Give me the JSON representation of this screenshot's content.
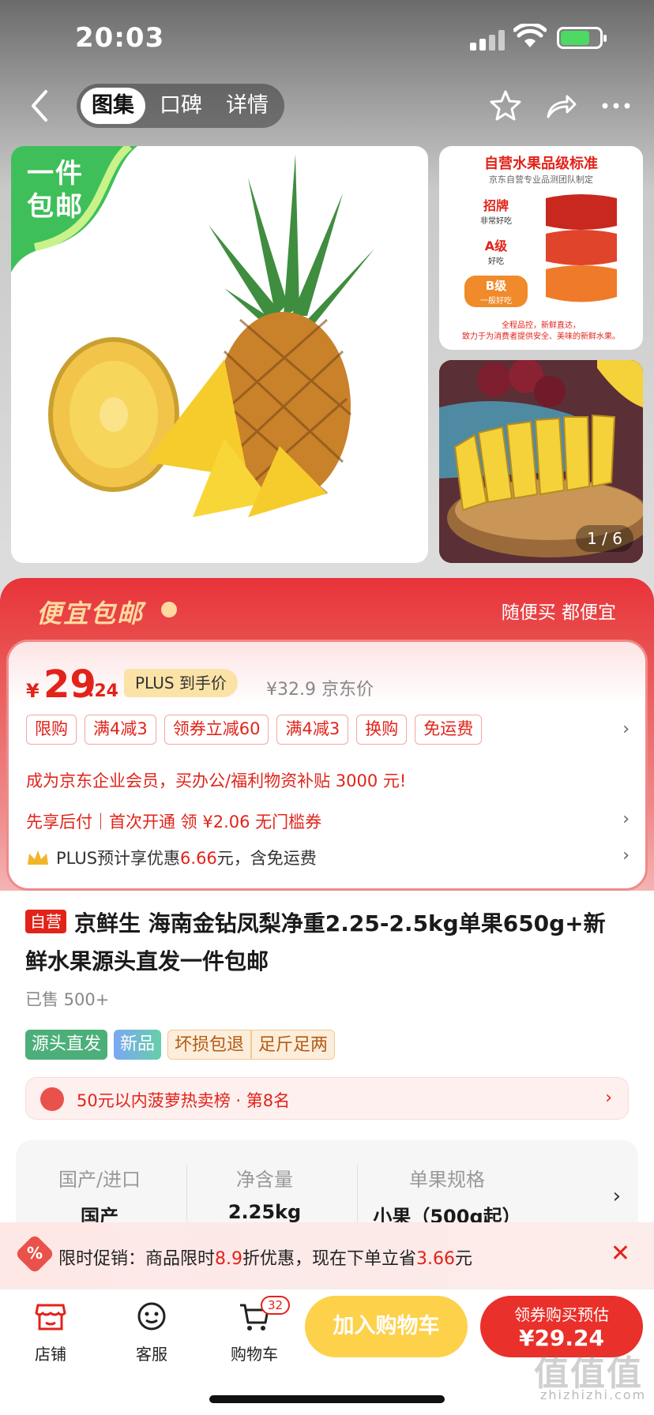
{
  "status_bar": {
    "time": "20:03"
  },
  "nav": {
    "tabs": [
      {
        "label": "图集",
        "active": true
      },
      {
        "label": "口碑",
        "active": false
      },
      {
        "label": "详情",
        "active": false
      }
    ]
  },
  "gallery": {
    "badge": "一件包邮",
    "grade_card": {
      "title": "自营水果品级标准",
      "subtitle": "京东自营专业品测团队制定",
      "grades": [
        {
          "name": "招牌",
          "desc": "非常好吃"
        },
        {
          "name": "A级",
          "desc": "好吃"
        },
        {
          "name": "B级",
          "desc": "一般好吃"
        }
      ],
      "footer_line1": "全程品控，新鲜直达，",
      "footer_line2": "致力于为消费者提供安全、美味的新鲜水果。"
    },
    "counter_current": "1",
    "counter_total": "6"
  },
  "promo": {
    "title": "便宜包邮",
    "slogan": "随便买 都便宜",
    "price_int": "29",
    "price_dec": ".24",
    "currency": "¥",
    "plus_label": "PLUS 到手价",
    "jd_price": "¥32.9 京东价",
    "tags": [
      "限购",
      "满4减3",
      "领券立减60",
      "满4减3",
      "换购",
      "免运费"
    ],
    "business_line": "成为京东企业会员，买办公/福利物资补贴 3000 元!",
    "pay_line": "先享后付｜首次开通 领 ¥2.06 无门槛券",
    "plus_line_prefix": "PLUS预计享优惠",
    "plus_line_amount": "6.66",
    "plus_line_suffix": "元，含免运费"
  },
  "product": {
    "self_tag": "自营",
    "title": "京鲜生 海南金钻凤梨净重2.25-2.5kg单果650g+新鲜水果源头直发一件包邮",
    "sold": "已售 500+",
    "chips": [
      "源头直发",
      "新品",
      "坏损包退",
      "足斤足两"
    ],
    "rank": "50元以内菠萝热卖榜 · 第8名"
  },
  "specs": [
    {
      "label": "国产/进口",
      "value": "国产"
    },
    {
      "label": "净含量",
      "value": "2.25kg"
    },
    {
      "label": "单果规格",
      "value": "小果（500g起）"
    }
  ],
  "flash": {
    "prefix": "限时促销：商品限时",
    "discount": "8.9",
    "middle": "折优惠，现在下单立省",
    "save": "3.66",
    "suffix": "元"
  },
  "bottom_bar": {
    "store": "店铺",
    "service": "客服",
    "cart": "购物车",
    "cart_count": "32",
    "add_cart": "加入购物车",
    "buy_top": "领券购买预估",
    "buy_price": "¥29.24"
  },
  "watermark": {
    "main": "值值值",
    "sub": "zhizhizhi.com"
  },
  "colors": {
    "jd_red": "#e2231a",
    "cart_yellow": "#fdd14a",
    "green": "#4caf7a"
  }
}
